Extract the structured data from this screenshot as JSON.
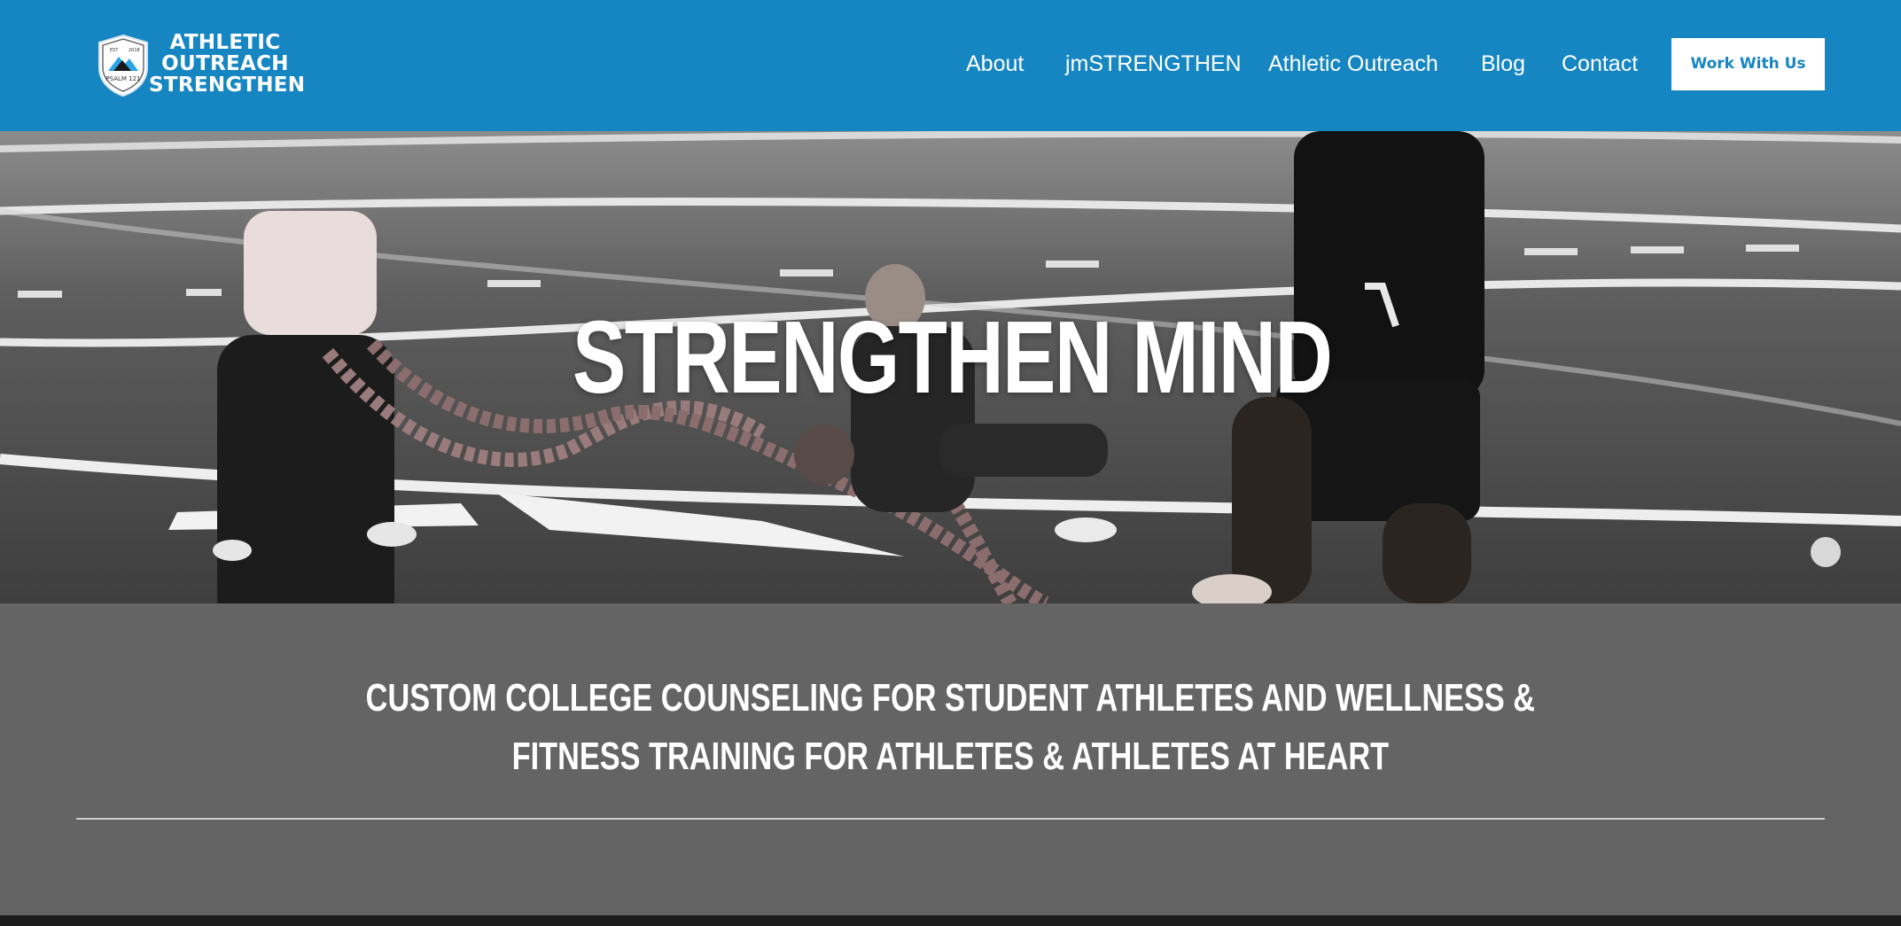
{
  "brand": {
    "logo_lines": [
      "ATHLETIC",
      "OUTREACH",
      "STRENGTHEN"
    ],
    "badge_lines": [
      "EST",
      "2018",
      "PSALM 121"
    ],
    "colors": {
      "header": "#1686c2",
      "cta_text": "#1686c2",
      "section_bg": "#646464"
    }
  },
  "nav": {
    "items": [
      {
        "label": "About"
      },
      {
        "label": "jmSTRENGTHEN"
      },
      {
        "label": "Athletic Outreach"
      },
      {
        "label": "Blog"
      },
      {
        "label": "Contact"
      }
    ],
    "cta_label": "Work With Us"
  },
  "hero": {
    "title": "STRENGTHEN MIND"
  },
  "tagline": {
    "lines": [
      "CUSTOM COLLEGE COUNSELING FOR STUDENT ATHLETES AND WELLNESS &",
      "FITNESS TRAINING FOR ATHLETES & ATHLETES AT HEART"
    ]
  }
}
